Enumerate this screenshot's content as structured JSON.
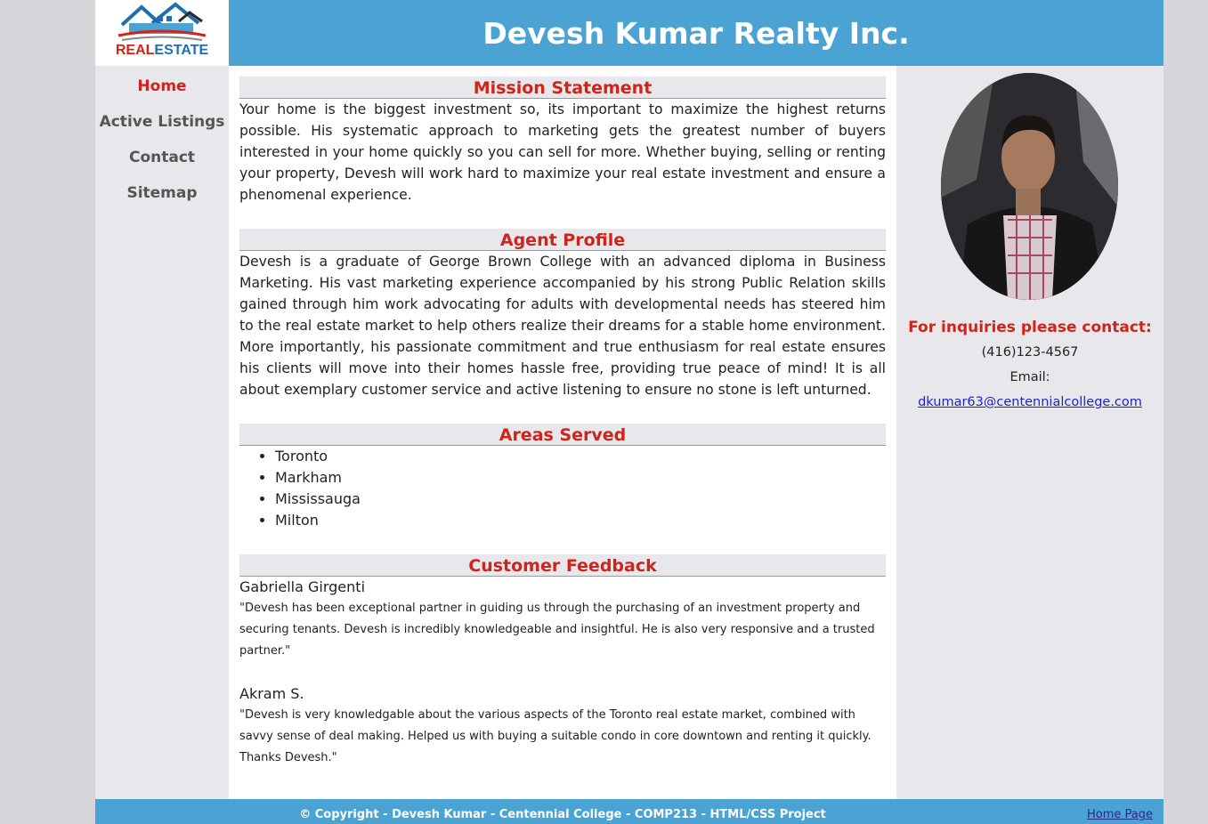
{
  "header": {
    "logo_text_red": "REAL",
    "logo_text_blue": "ESTATE",
    "title": "Devesh Kumar Realty Inc."
  },
  "nav": {
    "items": [
      {
        "label": "Home",
        "active": true
      },
      {
        "label": "Active Listings",
        "active": false
      },
      {
        "label": "Contact",
        "active": false
      },
      {
        "label": "Sitemap",
        "active": false
      }
    ]
  },
  "main": {
    "mission": {
      "title": "Mission Statement",
      "text": "Your home is the biggest investment so, its important to maximize the highest returns possible. His systematic approach to marketing gets the greatest number of buyers interested in your home quickly so you can sell for more. Whether buying, selling or renting your property, Devesh will work hard to maximize your real estate investment and ensure a phenomenal experience."
    },
    "profile": {
      "title": "Agent Profile",
      "text": "Devesh is a graduate of George Brown College with an advanced diploma in Business Marketing. His vast marketing experience accompanied by his strong Public Relation skills gained through him work advocating for adults with developmental needs has steered him to the real estate market to help others realize their dreams for a stable home environment. More importantly, his passionate commitment and true enthusiasm for real estate ensures his clients will move into their homes hassle free, providing true peace of mind! It is all about exemplary customer service and active listening to ensure no stone is left unturned."
    },
    "areas": {
      "title": "Areas Served",
      "items": [
        "Toronto",
        "Markham",
        "Mississauga",
        "Milton"
      ]
    },
    "feedback": {
      "title": "Customer Feedback",
      "entries": [
        {
          "name": "Gabriella Girgenti",
          "text": "\"Devesh has been exceptional partner in guiding us through the purchasing of an investment property and securing tenants. Devesh is incredibly knowledgeable and insightful. He is also very responsive and a trusted partner.\""
        },
        {
          "name": "Akram S.",
          "text": "\"Devesh is very knowledgable about the various aspects of the Toronto real estate market, combined with savvy sense of deal making. Helped us with buying a suitable condo in core downtown and renting it quickly. Thanks Devesh.\""
        }
      ]
    }
  },
  "aside": {
    "contact_heading": "For inquiries please contact:",
    "phone": "(416)123-4567",
    "email_label": "Email:",
    "email": "dkumar63@centennialcollege.com"
  },
  "footer": {
    "copyright": "©  Copyright - Devesh Kumar - Centennial College - COMP213 - HTML/CSS Project",
    "home_link": "Home Page"
  },
  "colors": {
    "accent_blue": "#4aa3d3",
    "heading_red": "#d0241a",
    "panel_gray": "#e8e8ec",
    "backdrop": "#d5d5da"
  }
}
